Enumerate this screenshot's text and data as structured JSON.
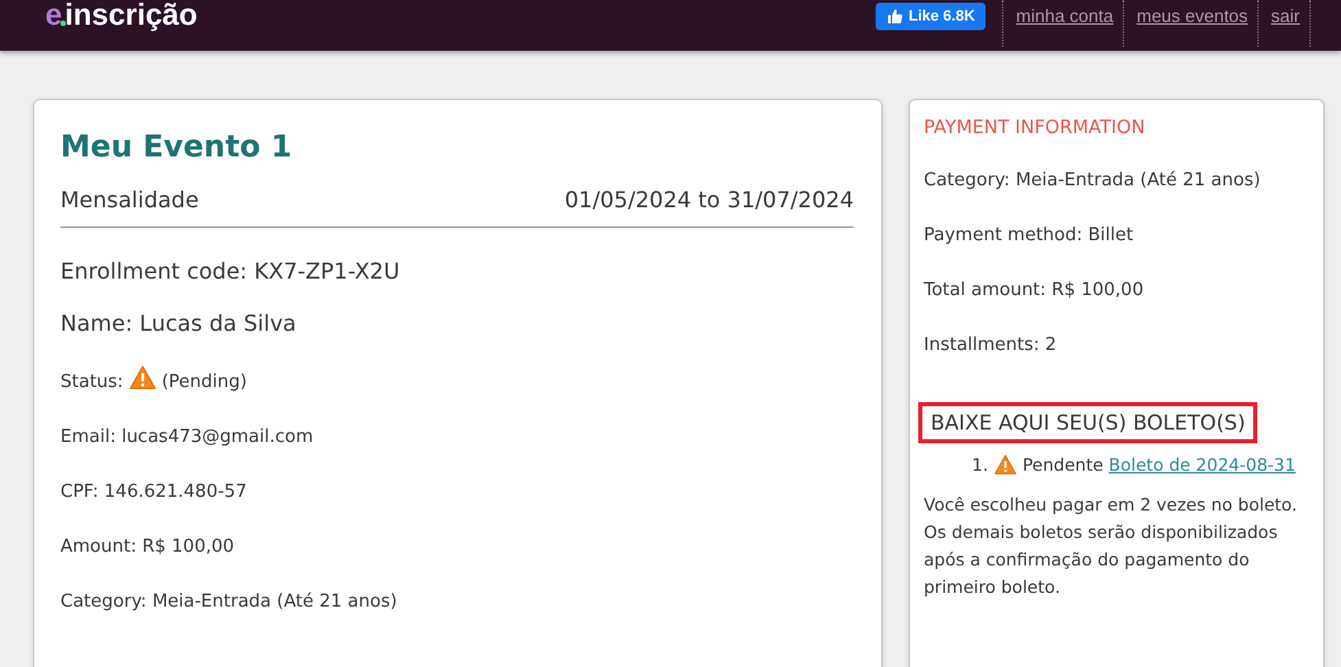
{
  "header": {
    "logo": {
      "mark": "e",
      "text": "inscrição"
    },
    "like_button": {
      "label": "Like",
      "count": "6.8K"
    },
    "nav": [
      "minha conta",
      "meus eventos",
      "sair"
    ]
  },
  "enrollment": {
    "title": "Meu Evento 1",
    "plan": "Mensalidade",
    "period": "01/05/2024 to 31/07/2024",
    "big_fields": [
      "Enrollment code: KX7-ZP1-X2U",
      "Name: Lucas da Silva"
    ],
    "fields": [
      {
        "kind": "status",
        "label": "Status:",
        "value": "(Pending)"
      },
      {
        "kind": "text",
        "label": "Email:",
        "value": "lucas473@gmail.com"
      },
      {
        "kind": "text",
        "label": "CPF:",
        "value": "146.621.480-57"
      },
      {
        "kind": "text",
        "label": "Amount:",
        "value": "R$ 100,00"
      },
      {
        "kind": "text",
        "label": "Category:",
        "value": "Meia-Entrada (Até 21 anos)"
      }
    ]
  },
  "payment": {
    "title": "PAYMENT INFORMATION",
    "lines": [
      "Category: Meia-Entrada (Até 21 anos)",
      "Payment method: Billet",
      "Total amount: R$ 100,00",
      "Installments: 2"
    ],
    "boletos_heading": "BAIXE AQUI SEU(S) BOLETO(S)",
    "boletos": [
      {
        "number": "1.",
        "status": "Pendente",
        "link": "Boleto de 2024-08-31"
      }
    ],
    "note": "Você escolheu pagar em 2 vezes no boleto. Os demais boletos serão disponibilizados após a confirmação do pagamento do primeiro boleto."
  }
}
